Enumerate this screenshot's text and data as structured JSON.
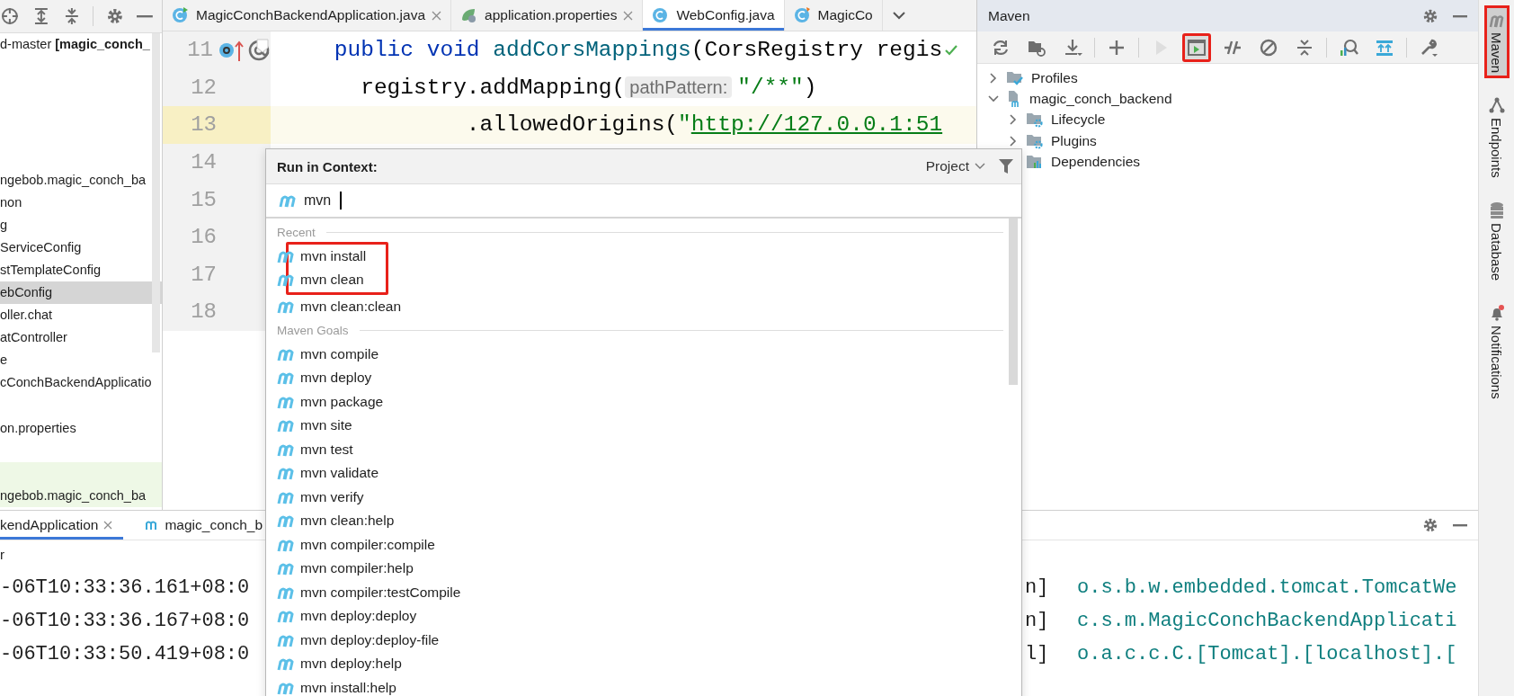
{
  "project_panel": {
    "items": [
      {
        "label": "d-master **[magic_conch_**",
        "selected": false,
        "tinted": false
      },
      {
        "selected": false,
        "tinted": false
      },
      {
        "selected": false,
        "tinted": false
      },
      {
        "selected": false,
        "tinted": false
      },
      {
        "selected": false,
        "tinted": false
      },
      {
        "selected": false,
        "tinted": false
      },
      {
        "label": "ngebob.magic_conch_ba",
        "selected": false,
        "tinted": false
      },
      {
        "label": "non",
        "selected": false,
        "tinted": false
      },
      {
        "label": "g",
        "selected": false,
        "tinted": false
      },
      {
        "label": "ServiceConfig",
        "selected": false,
        "tinted": false
      },
      {
        "label": "stTemplateConfig",
        "selected": false,
        "tinted": false
      },
      {
        "label": "ebConfig",
        "selected": true,
        "tinted": false
      },
      {
        "label": "oller.chat",
        "selected": false,
        "tinted": false
      },
      {
        "label": "atController",
        "selected": false,
        "tinted": false
      },
      {
        "label": "e",
        "selected": false,
        "tinted": false
      },
      {
        "label": "cConchBackendApplicatio",
        "selected": false,
        "tinted": false
      },
      {
        "selected": false,
        "tinted": false
      },
      {
        "label": "on.properties",
        "selected": false,
        "tinted": false
      },
      {
        "selected": false,
        "tinted": false
      },
      {
        "selected": false,
        "tinted": true
      },
      {
        "label": "ngebob.magic_conch_ba",
        "selected": false,
        "tinted": true
      }
    ]
  },
  "editor": {
    "tabs": [
      {
        "label": "MagicConchBackendApplication.java",
        "selected": false,
        "closable": true
      },
      {
        "label": "application.properties",
        "selected": false,
        "closable": true
      },
      {
        "label": "WebConfig.java",
        "selected": true,
        "closable": false
      },
      {
        "label": "MagicCo",
        "selected": false,
        "closable": false
      }
    ],
    "lines": [
      {
        "number": "11",
        "current": false,
        "tokens": [
          {
            "kind": "keyword",
            "text": "    public void "
          },
          {
            "kind": "method",
            "text": "addCorsMappings"
          },
          {
            "kind": "plain",
            "text": "(CorsRegistry regis"
          }
        ]
      },
      {
        "number": "12",
        "current": false,
        "tokens": [
          {
            "kind": "plain",
            "text": "      registry.addMapping("
          },
          {
            "kind": "hint",
            "text": "pathPattern:"
          },
          {
            "kind": "string",
            "text": "\"/**\""
          },
          {
            "kind": "plain",
            "text": ")"
          }
        ]
      },
      {
        "number": "13",
        "current": true,
        "tokens": [
          {
            "kind": "plain",
            "text": "              .allowedOrigins("
          },
          {
            "kind": "string",
            "text": "\""
          },
          {
            "kind": "link",
            "text": "http://127.0.0.1:51"
          }
        ]
      },
      {
        "number": "14",
        "current": false
      },
      {
        "number": "15",
        "current": false
      },
      {
        "number": "16",
        "current": false
      },
      {
        "number": "17",
        "current": false
      },
      {
        "number": "18",
        "current": false
      }
    ]
  },
  "maven": {
    "title": "Maven",
    "toolbar_groups": [
      {
        "tools": [
          {
            "disabled": false,
            "selected": false,
            "annotated": false
          },
          {
            "disabled": false,
            "selected": false,
            "annotated": false
          },
          {
            "disabled": false,
            "selected": false,
            "annotated": false
          }
        ]
      },
      {
        "tools": [
          {
            "disabled": false,
            "selected": false,
            "annotated": false
          }
        ]
      },
      {
        "tools": [
          {
            "disabled": true,
            "selected": false,
            "annotated": false
          },
          {
            "disabled": false,
            "selected": true,
            "annotated": true
          },
          {
            "disabled": false,
            "selected": false,
            "annotated": false
          },
          {
            "disabled": false,
            "selected": false,
            "annotated": false
          },
          {
            "disabled": false,
            "selected": false,
            "annotated": false
          }
        ]
      },
      {
        "tools": [
          {
            "disabled": false,
            "selected": false,
            "annotated": false
          },
          {
            "disabled": false,
            "selected": false,
            "annotated": false
          }
        ]
      },
      {
        "tools": [
          {
            "disabled": false,
            "selected": false,
            "annotated": false
          }
        ]
      }
    ],
    "tree": [
      {
        "label": "Profiles",
        "expanded": false
      },
      {
        "label": "magic_conch_backend",
        "expanded": true,
        "children": [
          {
            "label": "Lifecycle",
            "expanded": false
          },
          {
            "label": "Plugins",
            "expanded": false
          },
          {
            "label": "Dependencies"
          }
        ]
      }
    ]
  },
  "right_strip": [
    {
      "label": "Maven",
      "selected": true,
      "annotated": true
    },
    {
      "label": "Endpoints",
      "selected": false,
      "annotated": false
    },
    {
      "label": "Database",
      "selected": false,
      "annotated": false
    },
    {
      "label": "Notifications",
      "selected": false,
      "annotated": false
    }
  ],
  "bottom_panel": {
    "tabs": [
      {
        "label": "kendApplication",
        "selected": true
      },
      {
        "label": "magic_conch_b",
        "selected": false
      }
    ],
    "subheader": "r",
    "console": [
      {
        "time": "-06T10:33:36.161+08:0",
        "thread": "n]",
        "logger": "o.s.b.w.embedded.tomcat.TomcatWe"
      },
      {
        "time": "-06T10:33:36.167+08:0",
        "thread": "n]",
        "logger": "c.s.m.MagicConchBackendApplicati"
      },
      {
        "time": "-06T10:33:50.419+08:0",
        "thread": "l]",
        "logger": "o.a.c.c.C.[Tomcat].[localhost].["
      }
    ]
  },
  "popup": {
    "title": "Run in Context:",
    "scope": "Project",
    "query": "mvn",
    "sections": [
      {
        "title": "Recent",
        "items": [
          {
            "label": "mvn install",
            "annotated": true
          },
          {
            "label": "mvn clean",
            "annotated": true
          },
          {
            "label": "mvn clean:clean",
            "annotated": false
          }
        ]
      },
      {
        "title": "Maven Goals",
        "items": [
          {
            "label": "mvn compile",
            "annotated": false
          },
          {
            "label": "mvn deploy",
            "annotated": false
          },
          {
            "label": "mvn package",
            "annotated": false
          },
          {
            "label": "mvn site",
            "annotated": false
          },
          {
            "label": "mvn test",
            "annotated": false
          },
          {
            "label": "mvn validate",
            "annotated": false
          },
          {
            "label": "mvn verify",
            "annotated": false
          },
          {
            "label": "mvn clean:help",
            "annotated": false
          },
          {
            "label": "mvn compiler:compile",
            "annotated": false
          },
          {
            "label": "mvn compiler:help",
            "annotated": false
          },
          {
            "label": "mvn compiler:testCompile",
            "annotated": false
          },
          {
            "label": "mvn deploy:deploy",
            "annotated": false
          },
          {
            "label": "mvn deploy:deploy-file",
            "annotated": false
          },
          {
            "label": "mvn deploy:help",
            "annotated": false
          },
          {
            "label": "mvn install:help",
            "annotated": false
          }
        ]
      }
    ]
  }
}
